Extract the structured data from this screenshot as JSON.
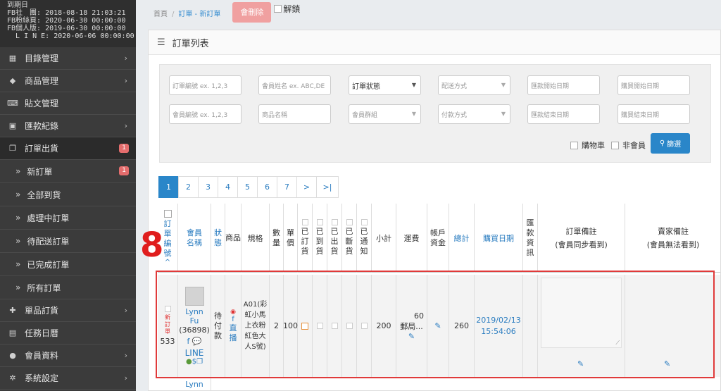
{
  "expiry": {
    "lines": [
      "到期日",
      "FB社　團: 2018-08-18 21:03:21",
      "FB粉絲頁: 2020-06-30 00:00:00",
      "FB個人版: 2019-06-30 00:00:00",
      "  L I N E: 2020-06-06 00:00:00"
    ]
  },
  "sidebar": {
    "items": [
      {
        "label": "目錄管理",
        "icon": "table-icon"
      },
      {
        "label": "商品管理",
        "icon": "tags-icon"
      },
      {
        "label": "貼文管理",
        "icon": "keyboard-icon"
      },
      {
        "label": "匯款紀錄",
        "icon": "money-icon"
      },
      {
        "label": "訂單出貨",
        "icon": "copy-icon",
        "badge": "1"
      }
    ],
    "sub_items": [
      {
        "label": "新訂單",
        "badge": "1"
      },
      {
        "label": "全部到貨"
      },
      {
        "label": "處理中訂單"
      },
      {
        "label": "待配送訂單"
      },
      {
        "label": "已完成訂單"
      },
      {
        "label": "所有訂單"
      }
    ],
    "bottom_items": [
      {
        "label": "單品訂貨",
        "icon": "gift-icon"
      },
      {
        "label": "任務日曆",
        "icon": "calendar-icon"
      },
      {
        "label": "會員資料",
        "icon": "user-icon"
      },
      {
        "label": "系統設定",
        "icon": "gear-icon"
      }
    ]
  },
  "breadcrumb": {
    "home": "首頁",
    "sep": "/",
    "current": "訂單 - 新訂單"
  },
  "toolbar": {
    "delete_label": "會刪除",
    "unlock_label": "解鎖"
  },
  "panel": {
    "title": "訂單列表"
  },
  "filters": {
    "order_no": "訂單編號 ex. 1,2,3",
    "member_name": "會員姓名 ex. ABC,DE",
    "order_status": "訂單狀態",
    "delivery": "配送方式",
    "remit_start": "匯款開始日期",
    "buy_start": "購買開始日期",
    "member_no": "會員編號 ex. 1,2,3",
    "product_name": "商品名稱",
    "member_group": "會員群組",
    "payment": "付款方式",
    "remit_end": "匯款結束日期",
    "buy_end": "購買結束日期",
    "cart_label": "購物車",
    "non_member_label": "非會員",
    "filter_button": "篩選"
  },
  "pager": {
    "pages": [
      "1",
      "2",
      "3",
      "4",
      "5",
      "6",
      "7"
    ],
    "next": ">",
    "last": ">|"
  },
  "table": {
    "headers": {
      "order_no": "訂單編號",
      "member_name": "會員名稱",
      "status": "狀態",
      "product": "商品",
      "spec": "規格",
      "qty": "數量",
      "price": "單價",
      "ordered": "已訂貨",
      "arrived": "已到貨",
      "shipped": "已出貨",
      "cutoff": "已斷貨",
      "notified": "已通知",
      "subtotal": "小計",
      "shipping": "運費",
      "account_funds": "帳戶資金",
      "total": "總計",
      "buy_date": "購買日期",
      "remit_info": "匯款資訊",
      "order_note": "訂單備註",
      "order_note_sub": "(會員同步看到)",
      "seller_note": "賣家備註",
      "seller_note_sub": "(會員無法看到)"
    },
    "row": {
      "new_tag": "新訂單",
      "order_no": "533",
      "member_first": "Lynn",
      "member_last": "Fu",
      "member_id": "(36898)",
      "channel": "LINE",
      "status": "待付款",
      "source": "直播",
      "spec": "A01(彩虹小馬上衣粉紅色大人S號)",
      "qty": "2",
      "price": "100",
      "subtotal": "200",
      "shipping": "60",
      "shipping_method": "郵局...",
      "total": "260",
      "buy_date": "2019/02/13",
      "buy_time": "15:54:06"
    },
    "next_row_member": "Lynn"
  },
  "annotation": {
    "label": "8",
    "color": "#e01e1e"
  }
}
